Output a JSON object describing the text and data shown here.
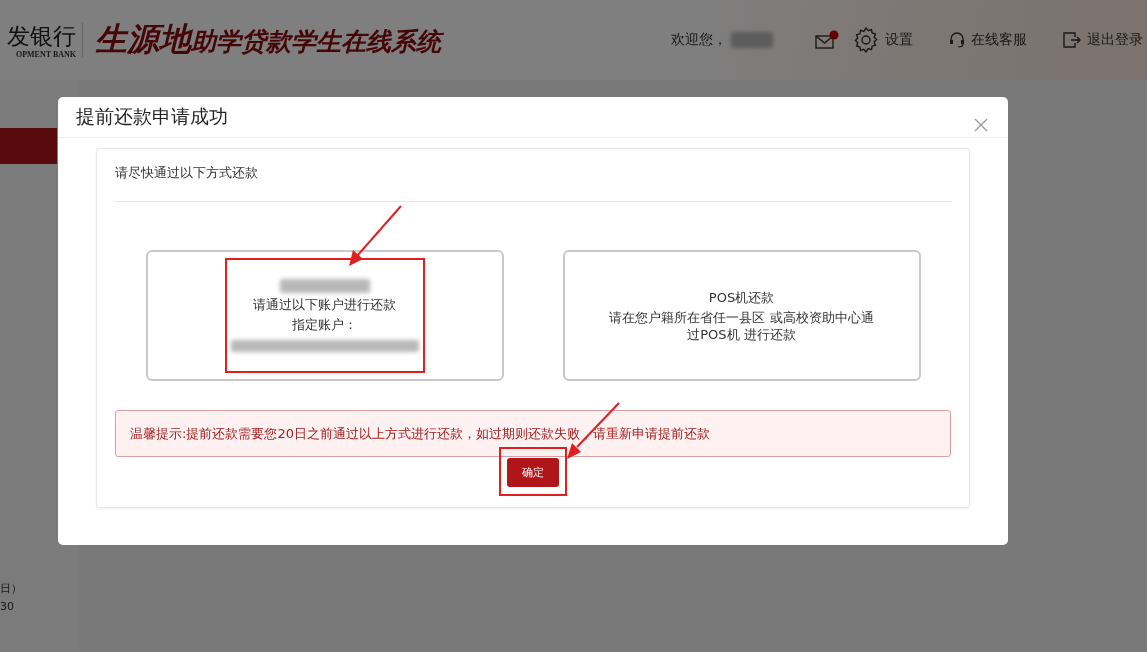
{
  "header": {
    "bank_name": "发银行",
    "bank_name_en": "OPMENT BANK",
    "system_title_lead": "生源地",
    "system_title": "助学贷款学生在线系统",
    "welcome": "欢迎您，",
    "messages_unread": true,
    "settings": "设置",
    "support": "在线客服",
    "logout": "退出登录"
  },
  "background_texts": [
    "日）",
    "30"
  ],
  "dialog": {
    "title": "提前还款申请成功",
    "instruction": "请尽快通过以下方式还款",
    "options": [
      {
        "kind": "account",
        "highlighted": true,
        "lines": [
          "请通过以下账户进行还款",
          "指定账户："
        ]
      },
      {
        "kind": "pos",
        "highlighted": false,
        "title": "POS机还款",
        "lines": [
          "请在您户籍所在省任一县区 或高校资助中心通过POS机 进行还款"
        ]
      }
    ],
    "notice": "温馨提示:提前还款需要您20日之前通过以上方式进行还款，如过期则还款失败，请重新申请提前还款",
    "confirm": {
      "label": "确定",
      "highlighted": true
    }
  }
}
